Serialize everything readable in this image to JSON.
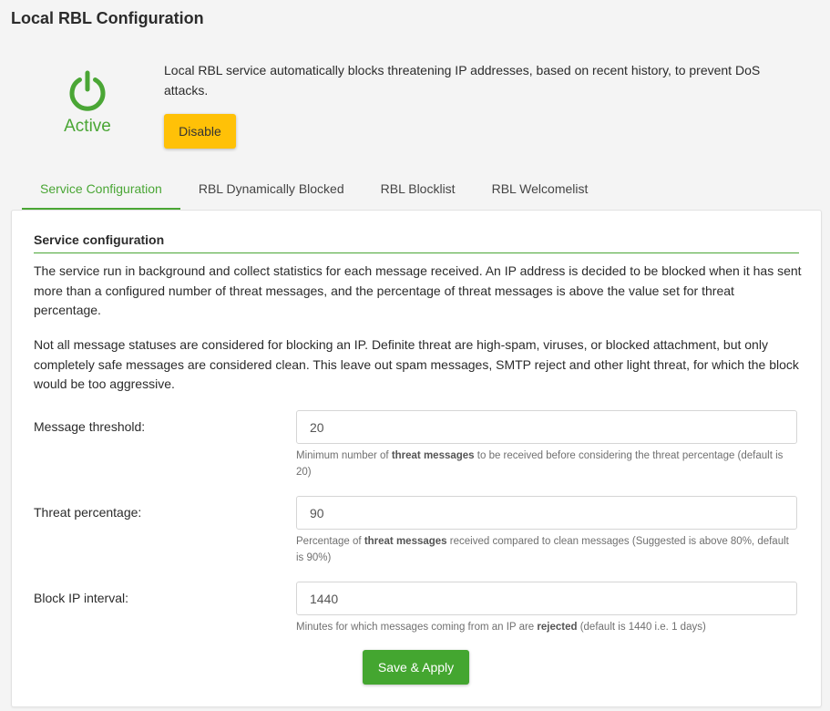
{
  "page": {
    "title": "Local RBL Configuration"
  },
  "status": {
    "icon": "power-icon",
    "label": "Active",
    "color": "#4aa635",
    "description": "Local RBL service automatically blocks threatening IP addresses, based on recent history, to prevent DoS attacks.",
    "disable_label": "Disable",
    "disable_color": "#ffc107"
  },
  "tabs": [
    {
      "label": "Service Configuration",
      "active": true
    },
    {
      "label": "RBL Dynamically Blocked",
      "active": false
    },
    {
      "label": "RBL Blocklist",
      "active": false
    },
    {
      "label": "RBL Welcomelist",
      "active": false
    }
  ],
  "section": {
    "title": "Service configuration",
    "paragraph1": "The service run in background and collect statistics for each message received. An IP address is decided to be blocked when it has sent more than a configured number of threat messages, and the percentage of threat messages is above the value set for threat percentage.",
    "paragraph2": "Not all message statuses are considered for blocking an IP. Definite threat are high-spam, viruses, or blocked attachment, but only completely safe messages are considered clean. This leave out spam messages, SMTP reject and other light threat, for which the block would be too aggressive."
  },
  "fields": {
    "threshold": {
      "label": "Message threshold:",
      "value": "20",
      "help_before": "Minimum number of ",
      "help_bold": "threat messages",
      "help_after": " to be received before considering the threat percentage (default is 20)"
    },
    "percentage": {
      "label": "Threat percentage:",
      "value": "90",
      "help_before": "Percentage of ",
      "help_bold": "threat messages",
      "help_after": " received compared to clean messages (Suggested is above 80%, default is 90%)"
    },
    "interval": {
      "label": "Block IP interval:",
      "value": "1440",
      "help_before": "Minutes for which messages coming from an IP are ",
      "help_bold": "rejected",
      "help_after": " (default is 1440 i.e. 1 days)"
    }
  },
  "actions": {
    "save_label": "Save & Apply",
    "save_color": "#44a630"
  }
}
